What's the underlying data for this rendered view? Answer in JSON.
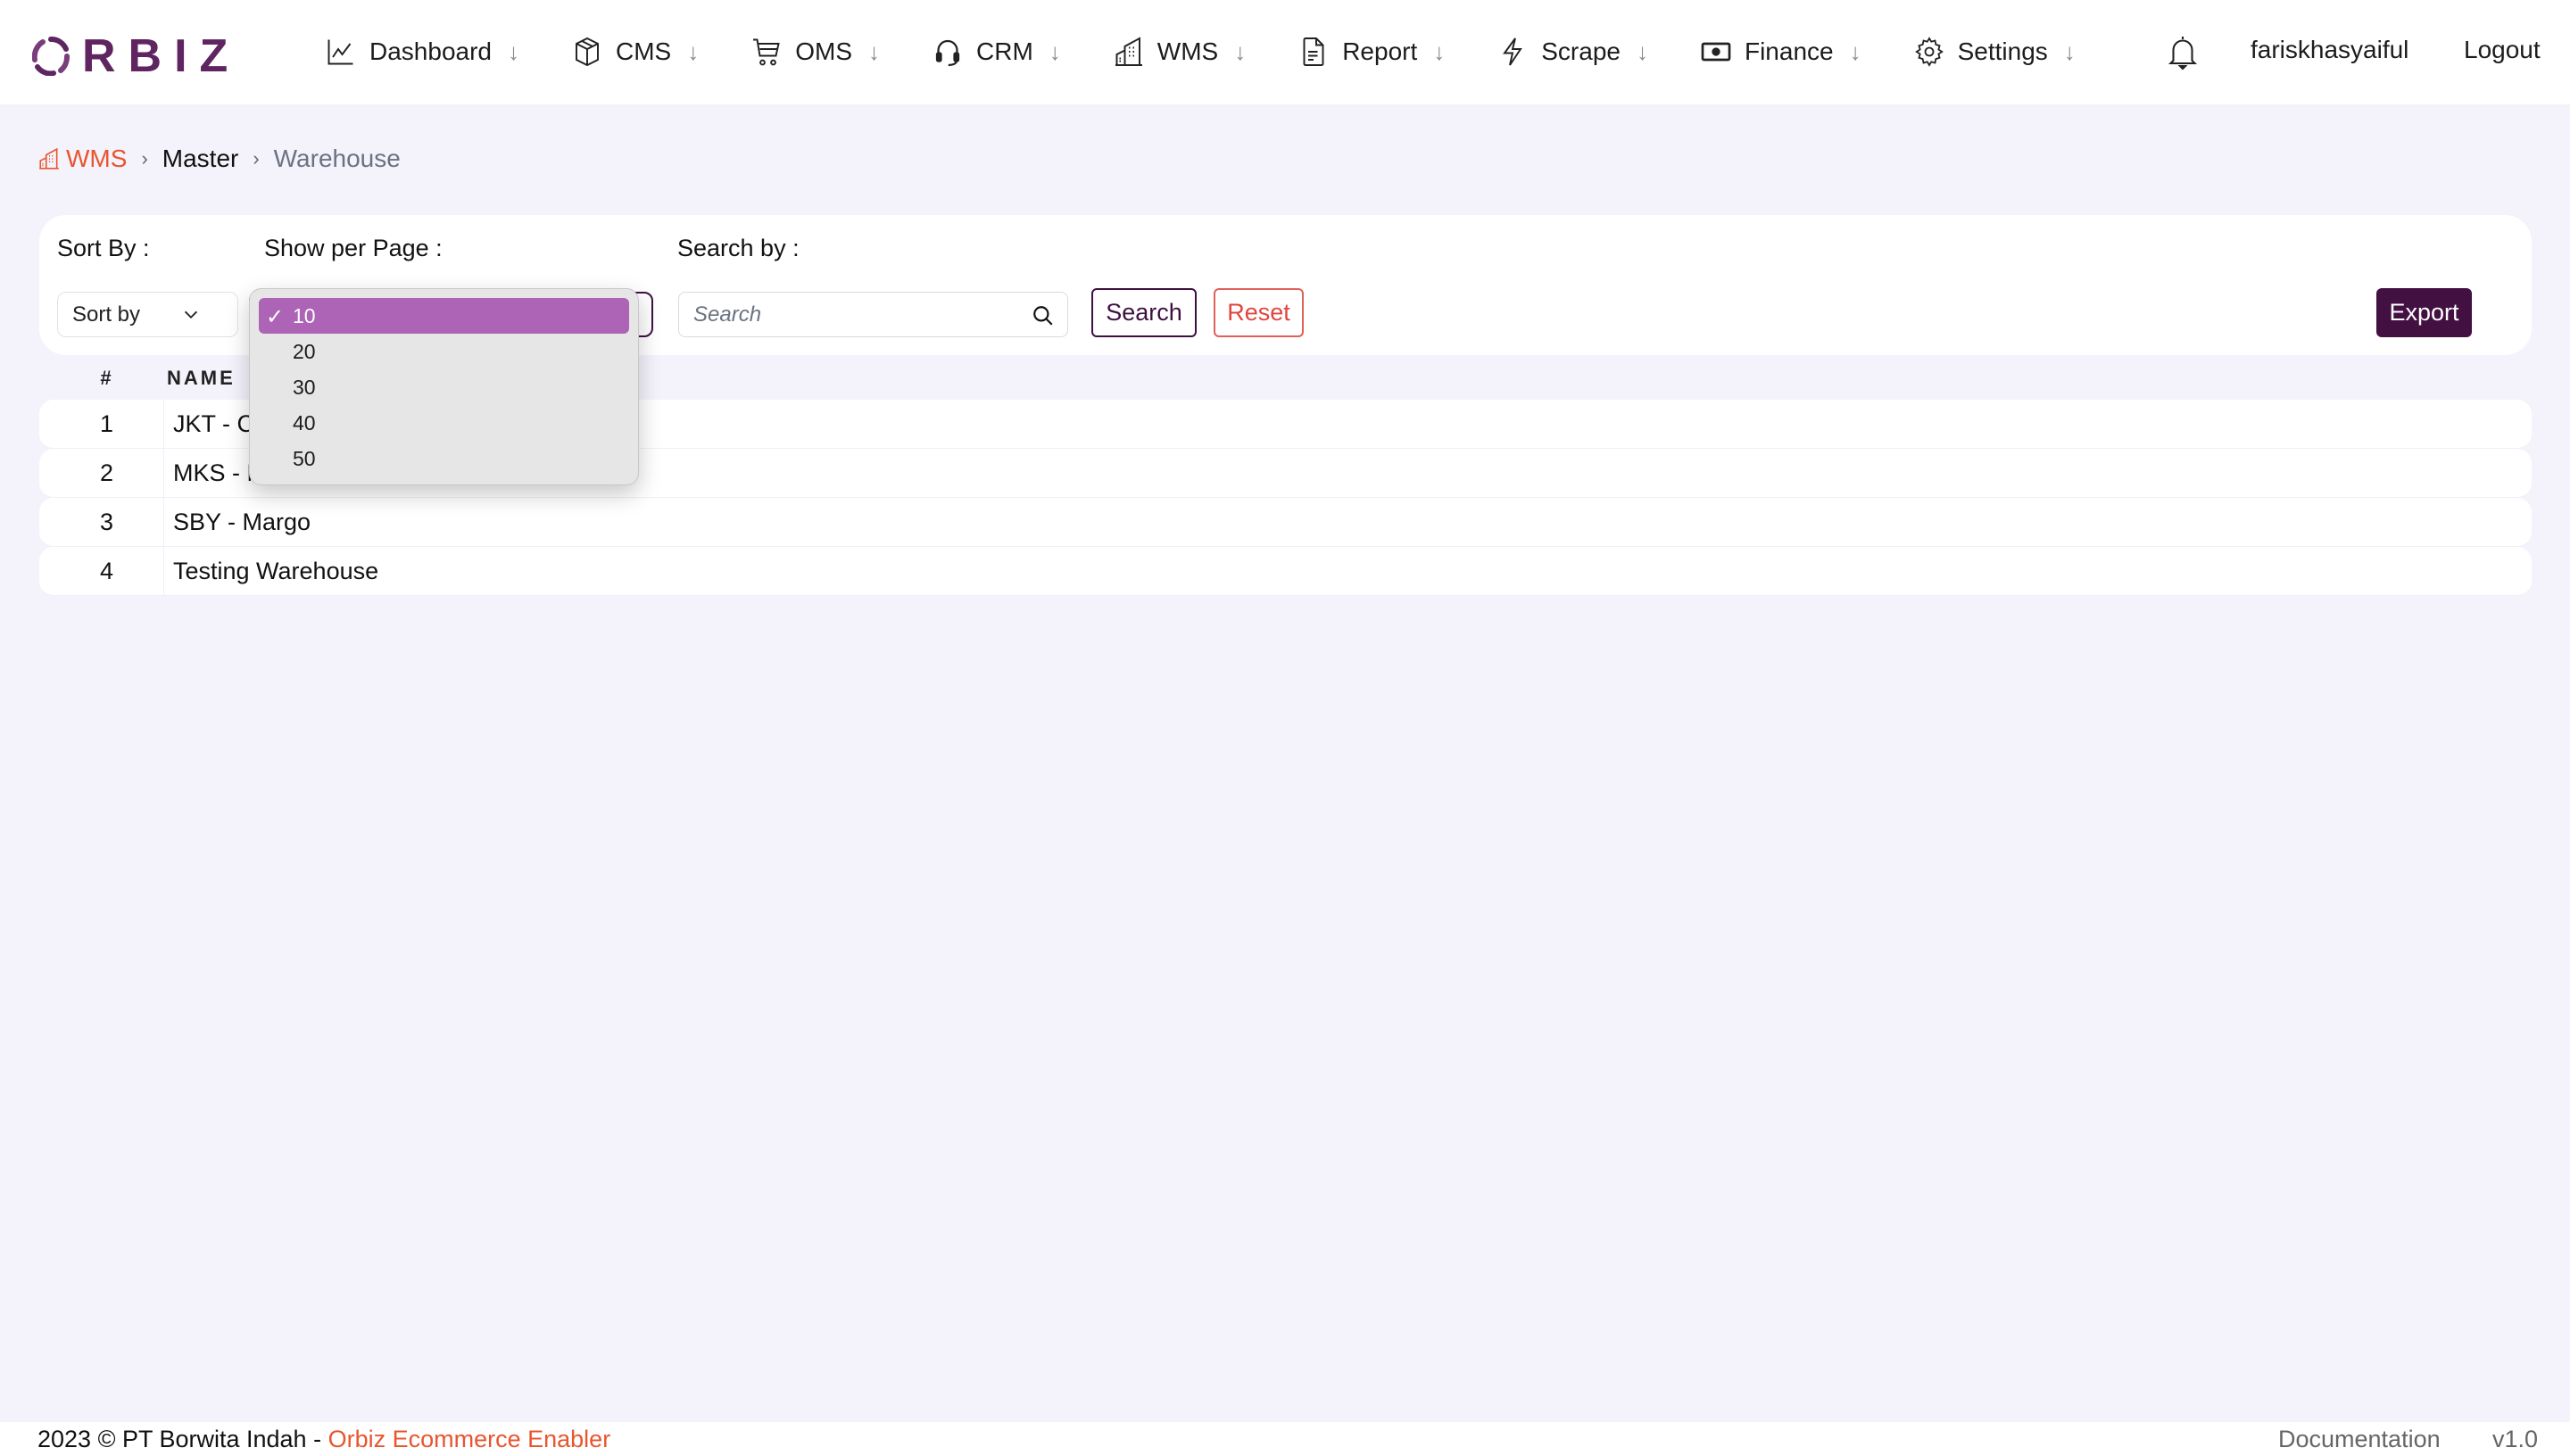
{
  "header": {
    "logo_text": "RBIZ",
    "brand_color": "#5f2561",
    "nav": [
      {
        "label": "Dashboard",
        "icon": "chart-line-icon"
      },
      {
        "label": "CMS",
        "icon": "box-icon"
      },
      {
        "label": "OMS",
        "icon": "cart-icon"
      },
      {
        "label": "CRM",
        "icon": "headset-icon"
      },
      {
        "label": "WMS",
        "icon": "building-icon"
      },
      {
        "label": "Report",
        "icon": "document-icon"
      },
      {
        "label": "Scrape",
        "icon": "lightning-icon"
      },
      {
        "label": "Finance",
        "icon": "money-icon"
      },
      {
        "label": "Settings",
        "icon": "gear-icon"
      }
    ],
    "dropdown_arrow": "↓",
    "username": "fariskhasyaiful",
    "logout_label": "Logout"
  },
  "breadcrumb": {
    "items": [
      "WMS",
      "Master",
      "Warehouse"
    ],
    "separator": "›",
    "accent_color": "#e8552f"
  },
  "filters": {
    "sort_label": "Sort By :",
    "sort_value": "Sort by",
    "per_page_label": "Show per Page :",
    "per_page_value": "10",
    "per_page_options": [
      "10",
      "20",
      "30",
      "40",
      "50"
    ],
    "search_label": "Search by :",
    "search_placeholder": "Search",
    "search_value": "",
    "search_button": "Search",
    "reset_button": "Reset",
    "export_button": "Export"
  },
  "dropdown": {
    "check_mark": "✓",
    "highlight_color": "#ad63b6"
  },
  "table": {
    "columns": [
      "#",
      "NAME"
    ],
    "rows": [
      {
        "num": "1",
        "name": "JKT - C"
      },
      {
        "num": "2",
        "name": "MKS - M"
      },
      {
        "num": "3",
        "name": "SBY - Margo"
      },
      {
        "num": "4",
        "name": "Testing Warehouse"
      }
    ]
  },
  "footer": {
    "copyright": "2023 © PT Borwita Indah - ",
    "brand": "Orbiz Ecommerce Enabler",
    "documentation": "Documentation",
    "version": "v1.0"
  }
}
